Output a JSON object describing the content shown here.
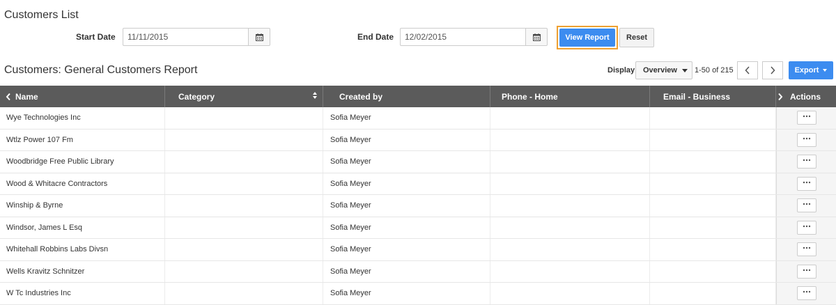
{
  "page": {
    "title": "Customers List"
  },
  "filters": {
    "start_label": "Start Date",
    "start_value": "11/11/2015",
    "end_label": "End Date",
    "end_value": "12/02/2015",
    "view_report": "View Report",
    "reset": "Reset"
  },
  "report": {
    "title": "Customers: General Customers Report",
    "display_label": "Display",
    "display_value": "Overview",
    "pager_text": "1-50 of 215",
    "export": "Export"
  },
  "columns": {
    "name": "Name",
    "category": "Category",
    "created_by": "Created by",
    "phone_home": "Phone - Home",
    "email_business": "Email - Business",
    "actions": "Actions"
  },
  "rows": [
    {
      "name": "Wye Technologies Inc",
      "category": "",
      "created_by": "Sofia Meyer",
      "phone": "",
      "email": ""
    },
    {
      "name": "Wtlz Power 107 Fm",
      "category": "",
      "created_by": "Sofia Meyer",
      "phone": "",
      "email": ""
    },
    {
      "name": "Woodbridge Free Public Library",
      "category": "",
      "created_by": "Sofia Meyer",
      "phone": "",
      "email": ""
    },
    {
      "name": "Wood & Whitacre Contractors",
      "category": "",
      "created_by": "Sofia Meyer",
      "phone": "",
      "email": ""
    },
    {
      "name": "Winship & Byrne",
      "category": "",
      "created_by": "Sofia Meyer",
      "phone": "",
      "email": ""
    },
    {
      "name": "Windsor, James L Esq",
      "category": "",
      "created_by": "Sofia Meyer",
      "phone": "",
      "email": ""
    },
    {
      "name": "Whitehall Robbins Labs Divsn",
      "category": "",
      "created_by": "Sofia Meyer",
      "phone": "",
      "email": ""
    },
    {
      "name": "Wells Kravitz Schnitzer",
      "category": "",
      "created_by": "Sofia Meyer",
      "phone": "",
      "email": ""
    },
    {
      "name": "W Tc Industries Inc",
      "category": "",
      "created_by": "Sofia Meyer",
      "phone": "",
      "email": ""
    }
  ],
  "icons": {
    "calendar": "calendar-icon",
    "prev": "chevron-left-icon",
    "next": "chevron-right-icon",
    "sort": "sort-icon",
    "more": "more-dots-icon"
  },
  "colors": {
    "primary": "#3c8cf0",
    "highlight": "#f0a030",
    "header": "#5b5b5b"
  }
}
